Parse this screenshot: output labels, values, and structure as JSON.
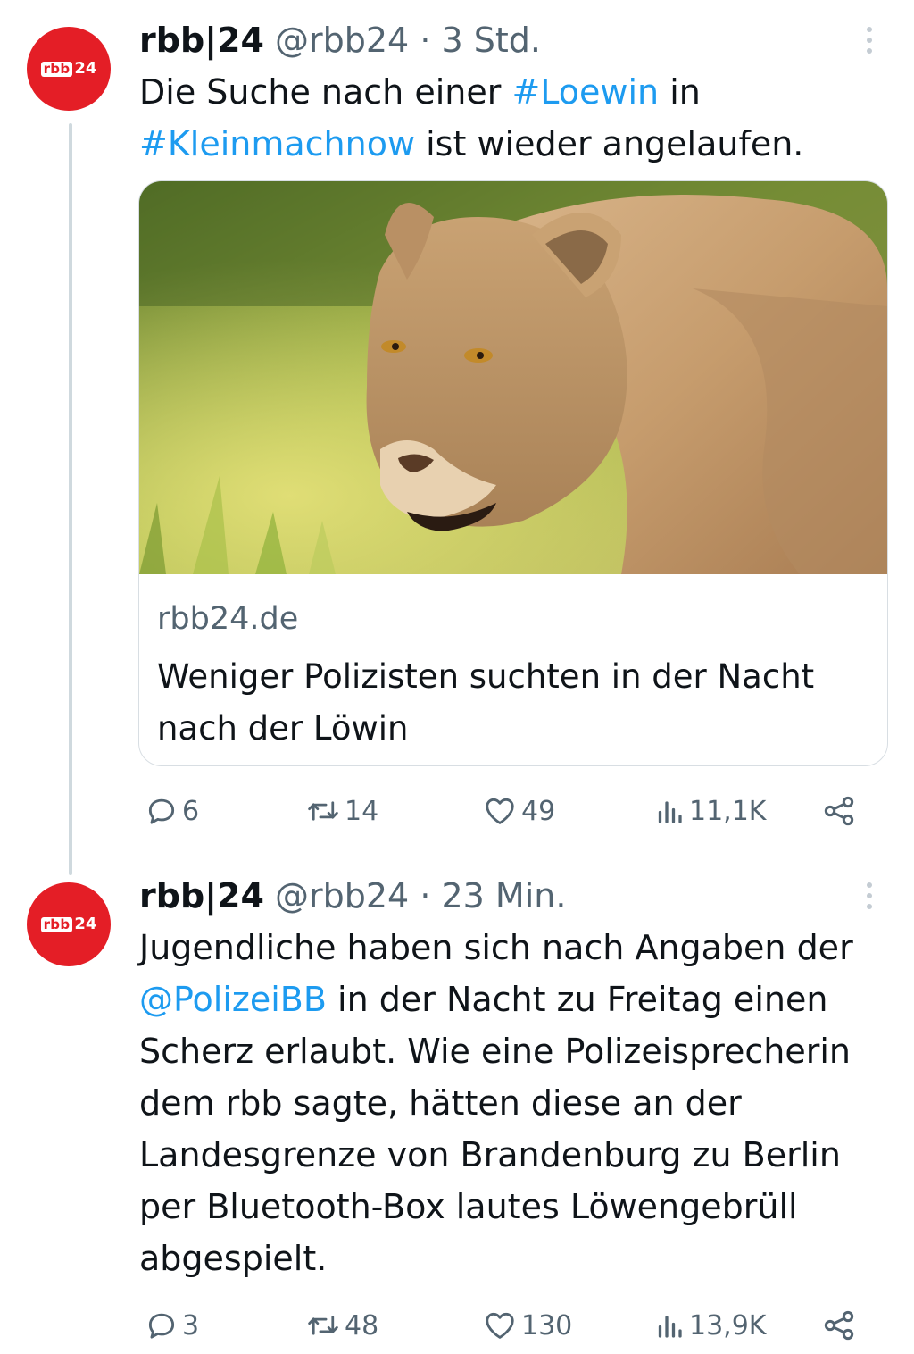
{
  "tweets": [
    {
      "avatar": {
        "logo_text": "rbb",
        "logo_num": "24"
      },
      "name": "rbb|24",
      "handle": "@rbb24",
      "separator": "·",
      "time": "3 Std.",
      "text": {
        "p1": "Die Suche nach einer ",
        "h1": "#Loewin",
        "p2": " in ",
        "h2": "#Kleinmachnow",
        "p3": " ist wieder angelaufen."
      },
      "card": {
        "image": "lioness-photo",
        "domain": "rbb24.de",
        "title": "Weniger Polizisten suchten in der Nacht nach der Löwin"
      },
      "actions": {
        "replies": "6",
        "retweets": "14",
        "likes": "49",
        "views": "11,1K"
      }
    },
    {
      "avatar": {
        "logo_text": "rbb",
        "logo_num": "24"
      },
      "name": "rbb|24",
      "handle": "@rbb24",
      "separator": "·",
      "time": "23 Min.",
      "text": {
        "l1": "Jugendliche haben sich nach Angaben der",
        "mention": "@PolizeiBB",
        "l2": " in der Nacht zu Freitag einen",
        "l3": "Scherz erlaubt. Wie eine Polizeisprecherin",
        "l4": "dem rbb sagte, hätten diese an der",
        "l5": "Landesgrenze von Brandenburg zu Berlin",
        "l6": "per Bluetooth-Box lautes Löwengebrüll",
        "l7": "abgespielt."
      },
      "actions": {
        "replies": "3",
        "retweets": "48",
        "likes": "130",
        "views": "13,9K"
      }
    }
  ],
  "icons": [
    "more-icon",
    "reply-icon",
    "retweet-icon",
    "like-icon",
    "views-icon",
    "share-icon"
  ],
  "colors": {
    "brand_red": "#e41e26",
    "link_blue": "#1d9bf0",
    "secondary_text": "#536471"
  }
}
